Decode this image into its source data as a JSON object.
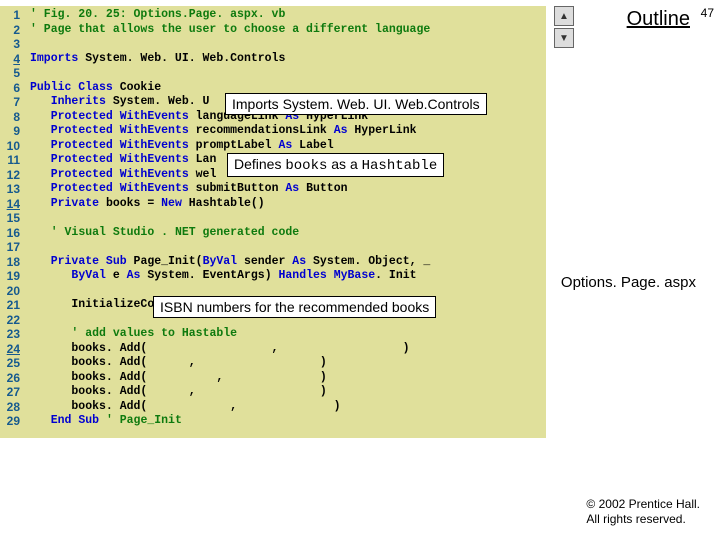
{
  "slideNumber": "47",
  "outlineTitle": "Outline",
  "pageLabel": "Options. Page. aspx",
  "copyright1": "© 2002 Prentice Hall.",
  "copyright2": "All rights reserved.",
  "callout1": "Imports System. Web. UI. Web.Controls",
  "callout2_a": "Defines ",
  "callout2_b": "books",
  "callout2_c": " as a ",
  "callout2_d": "Hashtable",
  "callout3": "ISBN numbers for the recommended books",
  "lineNumbers": [
    "1",
    "2",
    "3",
    "4",
    "5",
    "6",
    "7",
    "8",
    "9",
    "10",
    "11",
    "12",
    "13",
    "14",
    "15",
    "16",
    "17",
    "18",
    "19",
    "20",
    "21",
    "22",
    "23",
    "24",
    "25",
    "26",
    "27",
    "28",
    "29"
  ],
  "underlinedLines": [
    4,
    14,
    24
  ],
  "code": [
    [
      {
        "c": "comment",
        "t": "' Fig. 20. 25: Options.Page. aspx. vb"
      }
    ],
    [
      {
        "c": "comment",
        "t": "' Page that allows the user to choose a different language"
      }
    ],
    [],
    [
      {
        "c": "kw",
        "t": "Imports"
      },
      {
        "c": "plain",
        "t": " System. Web. UI. Web.Controls"
      }
    ],
    [],
    [
      {
        "c": "kw",
        "t": "Public Class "
      },
      {
        "c": "plain",
        "t": "Cookie"
      }
    ],
    [
      {
        "c": "plain",
        "t": "   "
      },
      {
        "c": "kw",
        "t": "Inherits"
      },
      {
        "c": "plain",
        "t": " System. Web. U"
      }
    ],
    [
      {
        "c": "plain",
        "t": "   "
      },
      {
        "c": "kw",
        "t": "Protected WithEvents"
      },
      {
        "c": "plain",
        "t": " languageLink "
      },
      {
        "c": "kw",
        "t": "As"
      },
      {
        "c": "plain",
        "t": " HyperLink"
      }
    ],
    [
      {
        "c": "plain",
        "t": "   "
      },
      {
        "c": "kw",
        "t": "Protected WithEvents"
      },
      {
        "c": "plain",
        "t": " recommendationsLink "
      },
      {
        "c": "kw",
        "t": "As"
      },
      {
        "c": "plain",
        "t": " HyperLink"
      }
    ],
    [
      {
        "c": "plain",
        "t": "   "
      },
      {
        "c": "kw",
        "t": "Protected WithEvents"
      },
      {
        "c": "plain",
        "t": " promptLabel "
      },
      {
        "c": "kw",
        "t": "As"
      },
      {
        "c": "plain",
        "t": " Label"
      }
    ],
    [
      {
        "c": "plain",
        "t": "   "
      },
      {
        "c": "kw",
        "t": "Protected WithEvents"
      },
      {
        "c": "plain",
        "t": " Lan"
      }
    ],
    [
      {
        "c": "plain",
        "t": "   "
      },
      {
        "c": "kw",
        "t": "Protected WithEvents"
      },
      {
        "c": "plain",
        "t": " wel"
      }
    ],
    [
      {
        "c": "plain",
        "t": "   "
      },
      {
        "c": "kw",
        "t": "Protected WithEvents"
      },
      {
        "c": "plain",
        "t": " submitButton "
      },
      {
        "c": "kw",
        "t": "As"
      },
      {
        "c": "plain",
        "t": " Button"
      }
    ],
    [
      {
        "c": "plain",
        "t": "   "
      },
      {
        "c": "kw",
        "t": "Private "
      },
      {
        "c": "plain",
        "t": "books = "
      },
      {
        "c": "kw",
        "t": "New"
      },
      {
        "c": "plain",
        "t": " Hashtable()"
      }
    ],
    [],
    [
      {
        "c": "plain",
        "t": "   "
      },
      {
        "c": "comment",
        "t": "' Visual Studio . NET generated code"
      }
    ],
    [],
    [
      {
        "c": "plain",
        "t": "   "
      },
      {
        "c": "kw",
        "t": "Private Sub "
      },
      {
        "c": "plain",
        "t": "Page_Init("
      },
      {
        "c": "kw",
        "t": "ByVal"
      },
      {
        "c": "plain",
        "t": " sender "
      },
      {
        "c": "kw",
        "t": "As"
      },
      {
        "c": "plain",
        "t": " System. Object, _"
      }
    ],
    [
      {
        "c": "plain",
        "t": "      "
      },
      {
        "c": "kw",
        "t": "ByVal"
      },
      {
        "c": "plain",
        "t": " e "
      },
      {
        "c": "kw",
        "t": "As"
      },
      {
        "c": "plain",
        "t": " System. EventArgs) "
      },
      {
        "c": "kw",
        "t": "Handles MyBase"
      },
      {
        "c": "plain",
        "t": ". Init"
      }
    ],
    [],
    [
      {
        "c": "plain",
        "t": "      InitializeCo"
      }
    ],
    [],
    [
      {
        "c": "plain",
        "t": "      "
      },
      {
        "c": "comment",
        "t": "' add values to Hastable"
      }
    ],
    [
      {
        "c": "plain",
        "t": "      books. Add(                  ,                  )"
      }
    ],
    [
      {
        "c": "plain",
        "t": "      books. Add(      ,                  )"
      }
    ],
    [
      {
        "c": "plain",
        "t": "      books. Add(          ,              )"
      }
    ],
    [
      {
        "c": "plain",
        "t": "      books. Add(      ,                  )"
      }
    ],
    [
      {
        "c": "plain",
        "t": "      books. Add(            ,              )"
      }
    ],
    [
      {
        "c": "plain",
        "t": "   "
      },
      {
        "c": "kw",
        "t": "End Sub "
      },
      {
        "c": "comment",
        "t": "' Page_Init"
      }
    ]
  ]
}
